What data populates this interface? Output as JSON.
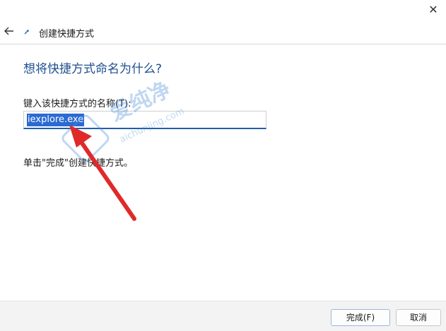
{
  "window": {
    "close_glyph": "✕"
  },
  "header": {
    "title": "创建快捷方式"
  },
  "main": {
    "heading": "想将快捷方式命名为什么?",
    "name_label": "键入该快捷方式的名称(T):",
    "name_value": "iexplore.exe",
    "instruction": "单击\"完成\"创建快捷方式。"
  },
  "watermark": {
    "cn": "爱纯净",
    "en": "aichunjing.com"
  },
  "footer": {
    "finish_label": "完成(F)",
    "cancel_label": "取消"
  },
  "colors": {
    "accent": "#1f5fa8",
    "selection": "#2a6ad2",
    "arrow": "#e02a2a",
    "heading": "#1f4f8f"
  },
  "icons": [
    "close-icon",
    "back-arrow-icon",
    "shortcut-wizard-icon",
    "annotation-arrow-icon"
  ]
}
